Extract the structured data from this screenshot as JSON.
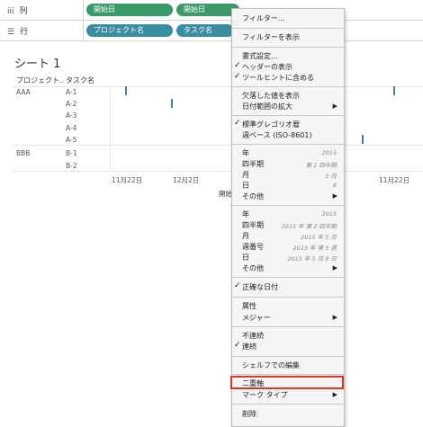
{
  "shelves": {
    "columns": {
      "label": "列",
      "icon": "columns-icon",
      "pills": [
        "開始日",
        "開始日"
      ]
    },
    "rows": {
      "label": "行",
      "icon": "rows-icon",
      "pills": [
        "プロジェクト名",
        "タスク名"
      ]
    }
  },
  "sheet": {
    "title": "シート 1"
  },
  "view": {
    "headers": {
      "project": "プロジェクト..",
      "task": "タスク名"
    },
    "projects": [
      "AAA",
      "BBB"
    ],
    "tasks": [
      "A-1",
      "A-2",
      "A-3",
      "A-4",
      "A-5",
      "B-1",
      "B-2"
    ],
    "axis_ticks": [
      "11月22日",
      "12月2日",
      "11月22日"
    ],
    "axis_title": "開始"
  },
  "menu": {
    "filter": "フィルター...",
    "show_filter": "フィルターを表示",
    "format": "書式設定...",
    "show_header": "ヘッダーの表示",
    "include_tooltip": "ツールヒントに含める",
    "show_missing": "欠落した値を表示",
    "expand_dates": "日付範囲の拡大",
    "gregorian": "標準グレゴリオ暦",
    "week_based": "週ベース (ISO-8601)",
    "d1_year": "年",
    "d1_year_hint": "2015",
    "d1_quarter": "四半期",
    "d1_quarter_hint": "第 2 四半期",
    "d1_month": "月",
    "d1_month_hint": "5 月",
    "d1_day": "日",
    "d1_day_hint": "8",
    "d1_more": "その他",
    "d2_year": "年",
    "d2_year_hint": "2015",
    "d2_quarter": "四半期",
    "d2_quarter_hint": "2015 年 第 2 四半期",
    "d2_month": "月",
    "d2_month_hint": "2015 年 5 月",
    "d2_week": "週番号",
    "d2_week_hint": "2015 年 第 5 週",
    "d2_day": "日",
    "d2_day_hint": "2015 年 5 月 8 日",
    "d2_more": "その他",
    "exact_date": "正確な日付",
    "attribute": "属性",
    "measure": "メジャー",
    "discrete": "不連続",
    "continuous": "連続",
    "edit_in_shelf": "シェルフでの編集",
    "dual_axis": "二重軸",
    "mark_type": "マーク タイプ",
    "remove": "削除"
  },
  "colors": {
    "pill_green": "#3c9a6a",
    "pill_teal": "#3a8ea3",
    "mark": "#4e79a7",
    "highlight_border": "#e0352b",
    "highlight_fill": "#9ab7ea"
  }
}
